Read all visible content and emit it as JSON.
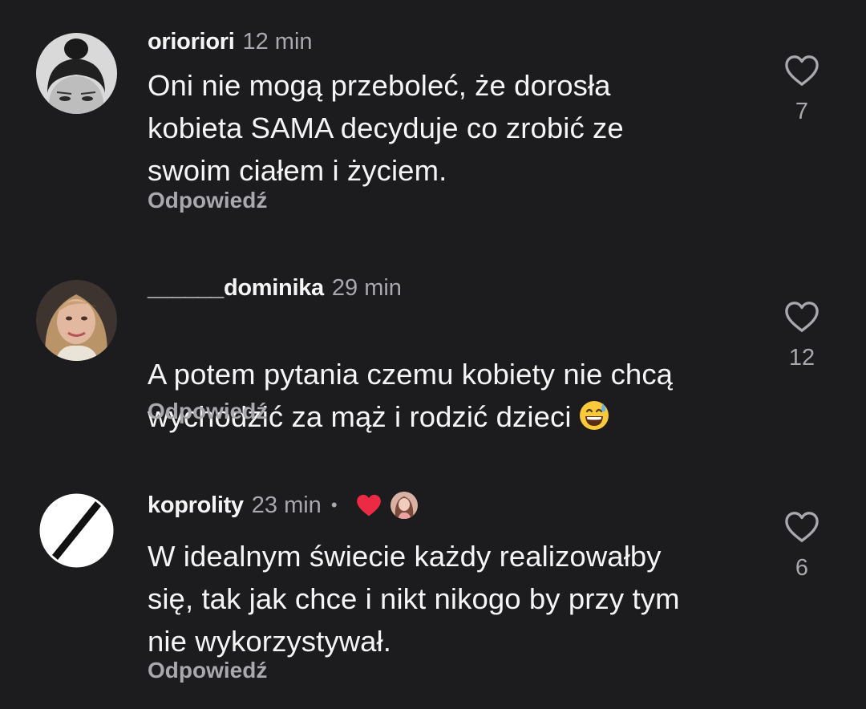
{
  "comments": [
    {
      "username": "orioriori",
      "time": "12 min",
      "text": "Oni nie mogą przeboleć, że dorosła\nkobieta SAMA decyduje co zrobić ze\nswoim ciałem i życiem.",
      "reply_label": "Odpowiedź",
      "like_count": "7",
      "avatar_icon": "avatar-photo-icon"
    },
    {
      "username": "______dominika",
      "time": "29 min",
      "text": "A potem pytania czemu kobiety nie chcą\nwychodzić za mąż i rodzić dzieci",
      "emoji": "grinning-face-with-sweat-emoji",
      "reply_label": "Odpowiedź",
      "like_count": "12",
      "avatar_icon": "avatar-photo-icon"
    },
    {
      "username": "koprolity",
      "time": "23 min",
      "separator": "•",
      "liked_by_author": true,
      "text": "W idealnym świecie każdy realizowałby\nsię, tak jak chce i nikt nikogo by przy tym\nnie wykorzystywał.",
      "reply_label": "Odpowiedź",
      "like_count": "6",
      "avatar_icon": "end-of-restrictions-sign-icon"
    }
  ],
  "colors": {
    "background": "#1c1c1f",
    "primary_text": "#f5f5f5",
    "secondary_text": "#a8a8ad",
    "liked_heart": "#ed2a43"
  }
}
